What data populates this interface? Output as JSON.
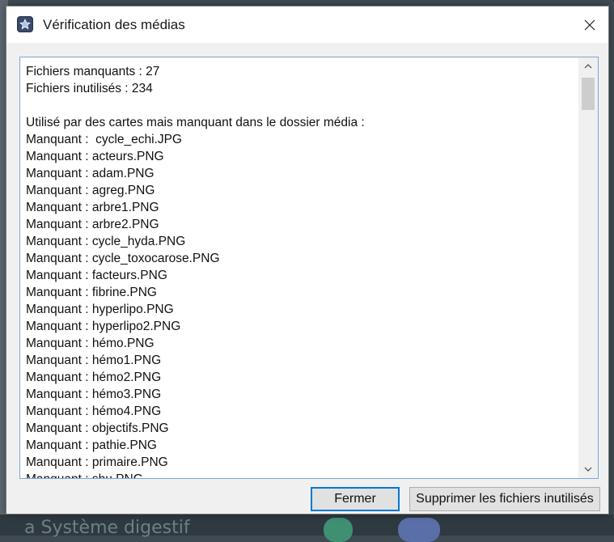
{
  "window": {
    "title": "Vérification des médias",
    "icon": "app-star-icon"
  },
  "report": {
    "lines": [
      "Fichiers manquants : 27",
      "Fichiers inutilisés : 234",
      "",
      "Utilisé par des cartes mais manquant dans le dossier média :",
      "Manquant :  cycle_echi.JPG",
      "Manquant : acteurs.PNG",
      "Manquant : adam.PNG",
      "Manquant : agreg.PNG",
      "Manquant : arbre1.PNG",
      "Manquant : arbre2.PNG",
      "Manquant : cycle_hyda.PNG",
      "Manquant : cycle_toxocarose.PNG",
      "Manquant : facteurs.PNG",
      "Manquant : fibrine.PNG",
      "Manquant : hyperlipo.PNG",
      "Manquant : hyperlipo2.PNG",
      "Manquant : hémo.PNG",
      "Manquant : hémo1.PNG",
      "Manquant : hémo2.PNG",
      "Manquant : hémo3.PNG",
      "Manquant : hémo4.PNG",
      "Manquant : objectifs.PNG",
      "Manquant : pathie.PNG",
      "Manquant : primaire.PNG",
      "Manquant : shu.PNG"
    ]
  },
  "buttons": {
    "close_label": "Fermer",
    "delete_unused_label": "Supprimer les fichiers inutilisés"
  },
  "background": {
    "partial_text": "a Système digestif"
  },
  "colors": {
    "accent": "#0078d7",
    "textbox_border": "#7aa7d6",
    "dialog_bg": "#f0f0f0"
  }
}
